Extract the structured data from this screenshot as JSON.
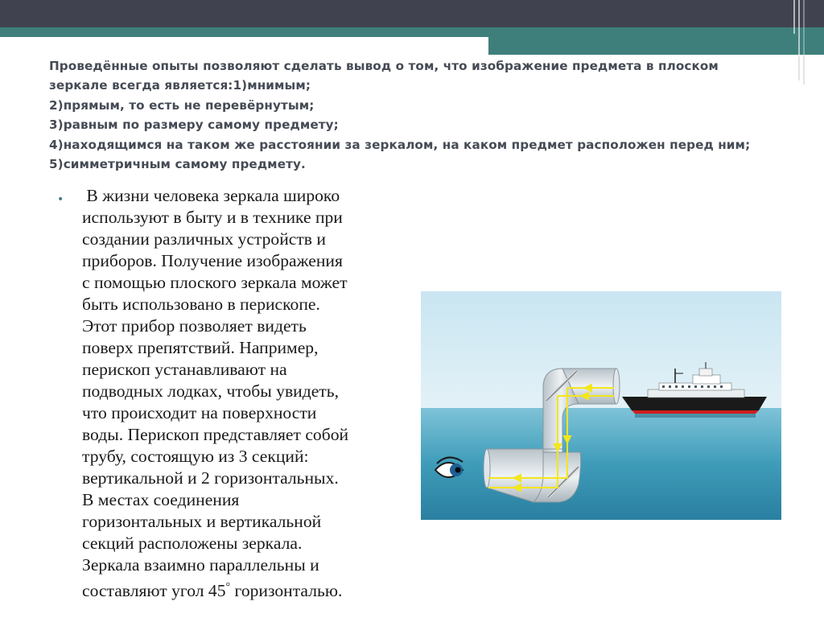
{
  "slide": {
    "title_lines": [
      "Проведённые опыты позволяют сделать вывод о том, что изображение предмета в плоском",
      "зеркале всегда является:1)мнимым;",
      "2)прямым, то есть не перевёрнутым;",
      "3)равным по размеру самому предмету;",
      "4)находящимся на таком же расстоянии за зеркалом, на каком предмет расположен перед ним;",
      "5)симметричным самому предмету."
    ],
    "bullet_symbol": "•",
    "body_lines": [
      " В жизни человека зеркала широко",
      "используют в быту и в технике при",
      "создании различных устройств и",
      "приборов. Получение изображения",
      "с помощью плоского зеркала может",
      "быть использовано в перископе.",
      "Этот прибор позволяет видеть",
      "поверх препятствий. Например,",
      "перископ устанавливают на",
      "подводных лодках, чтобы увидеть,",
      "что происходит на поверхности",
      "воды. Перископ представляет собой",
      "трубу, состоящую из 3 секций:",
      "вертикальной и 2 горизонтальных.",
      "В местах соединения",
      "горизонтальных и вертикальной",
      "секций расположены зеркала.",
      "Зеркала взаимно параллельны и"
    ],
    "last_line_prefix": "составляют угол 45",
    "last_line_degree": "°",
    "last_line_suffix": " горизонталью."
  },
  "theme": {
    "dark_band": "#40424f",
    "teal": "#3e7f7c",
    "title_color": "#454b55",
    "sky": "#cfe8f3",
    "sea": "#3d9bb8",
    "ray": "#f5ea1e"
  }
}
